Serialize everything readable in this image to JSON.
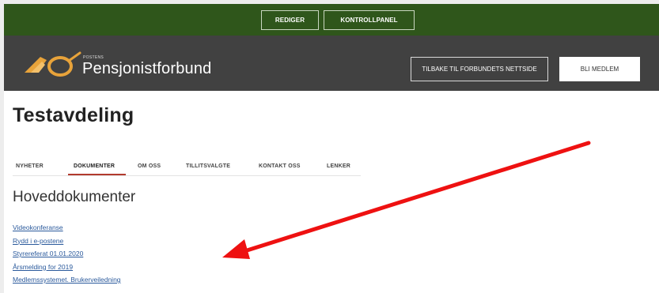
{
  "admin_bar": {
    "edit_label": "REDIGER",
    "panel_label": "KONTROLLPANEL"
  },
  "header": {
    "logo_small": "POSTENS",
    "logo_name": "Pensjonistforbund",
    "back_label": "TILBAKE TIL FORBUNDETS NETTSIDE",
    "join_label": "BLI MEDLEM"
  },
  "page": {
    "title": "Testavdeling",
    "tabs": [
      {
        "label": "NYHETER"
      },
      {
        "label": "DOKUMENTER",
        "active": true
      },
      {
        "label": "OM OSS"
      },
      {
        "label": "TILLITSVALGTE"
      },
      {
        "label": "KONTAKT OSS"
      },
      {
        "label": "LENKER"
      }
    ],
    "section_title": "Hoveddokumenter",
    "documents": [
      "Videokonferanse",
      "Rydd i e-postene",
      "Styrereferat 01.01.2020",
      "Årsmelding for 2019",
      "Medlemssystemet. Brukerveiledning"
    ]
  },
  "colors": {
    "admin_bar": "#2f561b",
    "header": "#414141",
    "logo_accent": "#e8a33a",
    "link": "#2b5a9c",
    "active_tab_underline": "#b23a2e",
    "annotation_arrow": "#ee1111"
  },
  "annotation": {
    "type": "red-arrow",
    "points_to": "documents-list"
  }
}
